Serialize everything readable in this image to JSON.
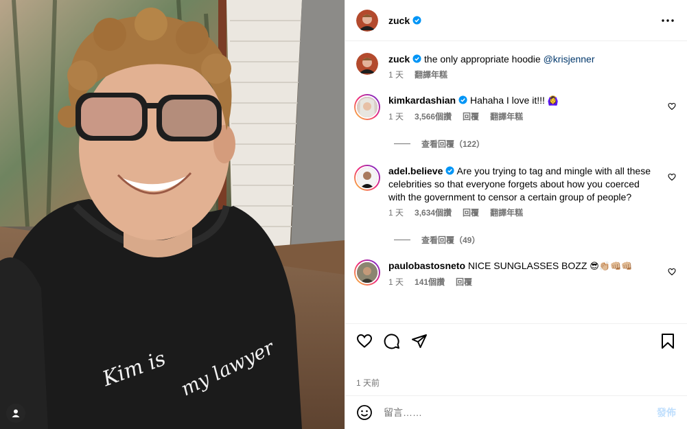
{
  "photo": {
    "shirt_text_line1": "Kim is",
    "shirt_text_line2": "my lawyer"
  },
  "post": {
    "author": "zuck",
    "caption": "the only appropriate hoodie",
    "mention": "@krisjenner",
    "caption_time": "1 天",
    "translate_label": "翻譯年糕",
    "posted_ago": "1 天前"
  },
  "comments": [
    {
      "username": "kimkardashian",
      "verified": true,
      "text": "Hahaha I love it!!!",
      "emoji": "🙆‍♀️",
      "time": "1 天",
      "likes": "3,566個讚",
      "reply_label": "回覆",
      "translate_label": "翻譯年糕",
      "view_replies": "查看回覆（122）"
    },
    {
      "username": "adel.believe",
      "verified": true,
      "text": "Are you trying to tag and mingle with all these celebrities so that everyone forgets about how you coerced with the government to censor a certain group of people?",
      "time": "1 天",
      "likes": "3,634個讚",
      "reply_label": "回覆",
      "translate_label": "翻譯年糕",
      "view_replies": "查看回覆（49）"
    },
    {
      "username": "paulobastosneto",
      "verified": false,
      "text": "NICE SUNGLASSES BOZZ",
      "emoji": "😎👏🏼👊🏼👊🏼",
      "time": "1 天",
      "likes": "141個讚",
      "reply_label": "回覆"
    }
  ],
  "composer": {
    "placeholder": "留言……",
    "post_label": "發佈"
  },
  "colors": {
    "verified_blue": "#0095f6",
    "muted_text": "#737373",
    "mention": "#00376b",
    "post_button_disabled": "#c0dffd"
  }
}
